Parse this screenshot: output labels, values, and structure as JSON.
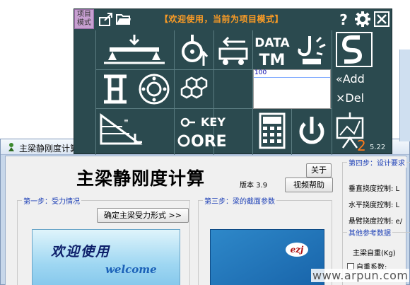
{
  "toolbar": {
    "mode_badge": "项目\n模式",
    "banner": "【欢迎使用，当前为项目模式】",
    "help_icon": "?",
    "version": "5.22",
    "text_area_value": "100",
    "add_label": "«Add",
    "del_label": "×Del",
    "data_label_top": "DATA",
    "data_label_bottom": "TM",
    "key_label_top": "KEY",
    "key_label_bottom": "ORE",
    "badge_number": "2"
  },
  "window": {
    "title": "主梁静刚度计算"
  },
  "main": {
    "heading": "主梁静刚度计算",
    "version_label": "版本 3.9",
    "about_button": "关于",
    "video_help_button": "视频帮助"
  },
  "step1": {
    "legend": "第一步：受力情况",
    "button": "确定主梁受力形式 >>",
    "welcome_cn": "欢迎使用",
    "welcome_en": "welcome"
  },
  "step3": {
    "legend": "第三步：梁的截面参数",
    "logo_text": "ezj"
  },
  "step4": {
    "legend": "第四步：设计要求",
    "rows": [
      "垂直挠度控制:  L",
      "水平挠度控制:  L",
      "悬臂挠度控制:  e/"
    ]
  },
  "other": {
    "legend": "其他参考数据",
    "self_weight_label": "主梁自重(Kg)",
    "coef_label": "自重系数:"
  },
  "watermark": "www.arpun.com",
  "colors": {
    "toolbar_bg": "#2b4a4f",
    "banner": "#ff9d24",
    "accent_blue": "#1c3fb6"
  }
}
